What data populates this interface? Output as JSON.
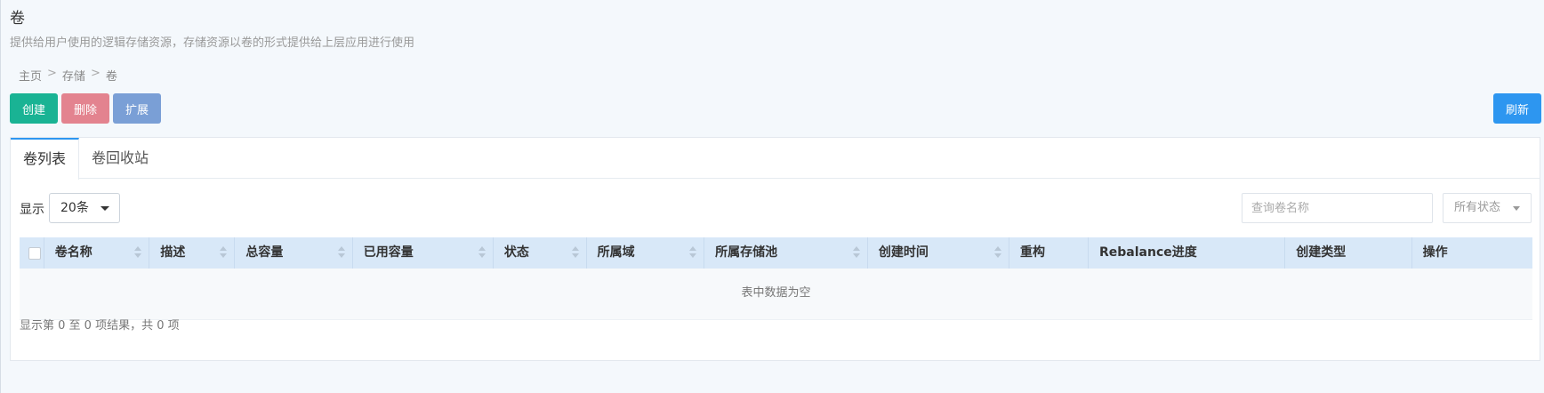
{
  "page": {
    "title": "卷",
    "description": "提供给用户使用的逻辑存储资源，存储资源以卷的形式提供给上层应用进行使用"
  },
  "breadcrumb": [
    "主页",
    "存储",
    "卷"
  ],
  "breadcrumb_separator": ">",
  "toolbar": {
    "create_label": "创建",
    "delete_label": "删除",
    "expand_label": "扩展",
    "refresh_label": "刷新"
  },
  "tabs": [
    {
      "label": "卷列表",
      "active": true
    },
    {
      "label": "卷回收站",
      "active": false
    }
  ],
  "list_controls": {
    "show_label": "显示",
    "page_size": "20条",
    "search_placeholder": "查询卷名称",
    "status_filter": "所有状态"
  },
  "table": {
    "columns": [
      "卷名称",
      "描述",
      "总容量",
      "已用容量",
      "状态",
      "所属域",
      "所属存储池",
      "创建时间",
      "重构",
      "Rebalance进度",
      "创建类型",
      "操作"
    ],
    "empty_text": "表中数据为空",
    "footer": "显示第 0 至 0 项结果，共 0 项"
  },
  "colors": {
    "create": "#19b394",
    "delete": "#e3838f",
    "expand": "#7a9fd6",
    "refresh": "#2d96f0",
    "table_header": "#d8e8f8"
  }
}
